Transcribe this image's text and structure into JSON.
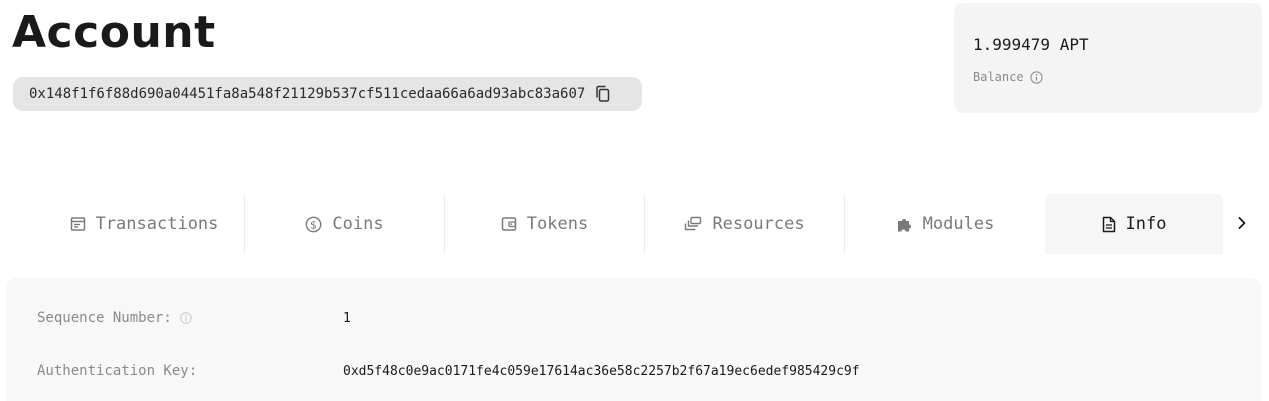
{
  "page": {
    "title": "Account",
    "address": "0x148f1f6f88d690a04451fa8a548f21129b537cf511cedaa66a6ad93abc83a607"
  },
  "balance": {
    "amount": "1.999479 APT",
    "label": "Balance"
  },
  "tabs": [
    {
      "label": "Transactions",
      "icon": "list-icon",
      "active": false
    },
    {
      "label": "Coins",
      "icon": "dollar-circle-icon",
      "active": false
    },
    {
      "label": "Tokens",
      "icon": "wallet-icon",
      "active": false
    },
    {
      "label": "Resources",
      "icon": "layers-icon",
      "active": false
    },
    {
      "label": "Modules",
      "icon": "puzzle-icon",
      "active": false
    },
    {
      "label": "Info",
      "icon": "document-icon",
      "active": true
    }
  ],
  "info": {
    "sequence_number_label": "Sequence Number:",
    "sequence_number_value": "1",
    "auth_key_label": "Authentication Key:",
    "auth_key_value": "0xd5f48c0e9ac0171fe4c059e17614ac36e58c2257b2f67a19ec6edef985429c9f"
  },
  "colors": {
    "text": "#1a1a1a",
    "muted": "#7a7a7a",
    "pill_bg": "#e5e5e5",
    "card_bg": "#f4f4f4"
  }
}
